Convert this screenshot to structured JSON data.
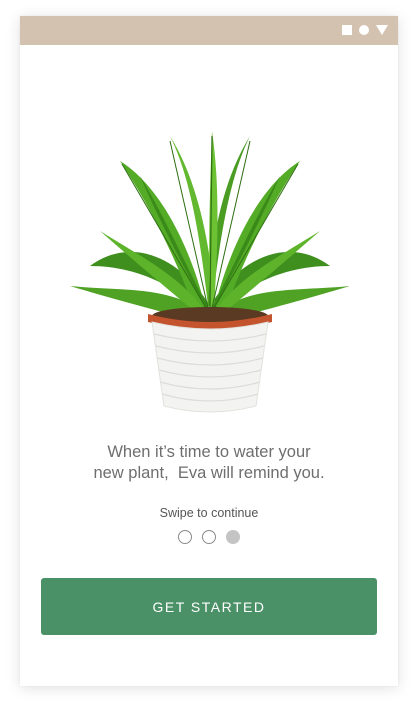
{
  "status_bar": {
    "color": "#d3c2b0",
    "icons": [
      "square-icon",
      "circle-icon",
      "triangle-icon"
    ]
  },
  "illustration": {
    "icon": "potted-fern-plant"
  },
  "onboarding": {
    "message_line1": "When it’s time to water your",
    "message_line2": "new plant,  Eva will remind you.",
    "swipe_hint": "Swipe to continue",
    "page_count": 3,
    "active_page": 3
  },
  "cta": {
    "label": "GET STARTED",
    "color": "#4a9167"
  }
}
